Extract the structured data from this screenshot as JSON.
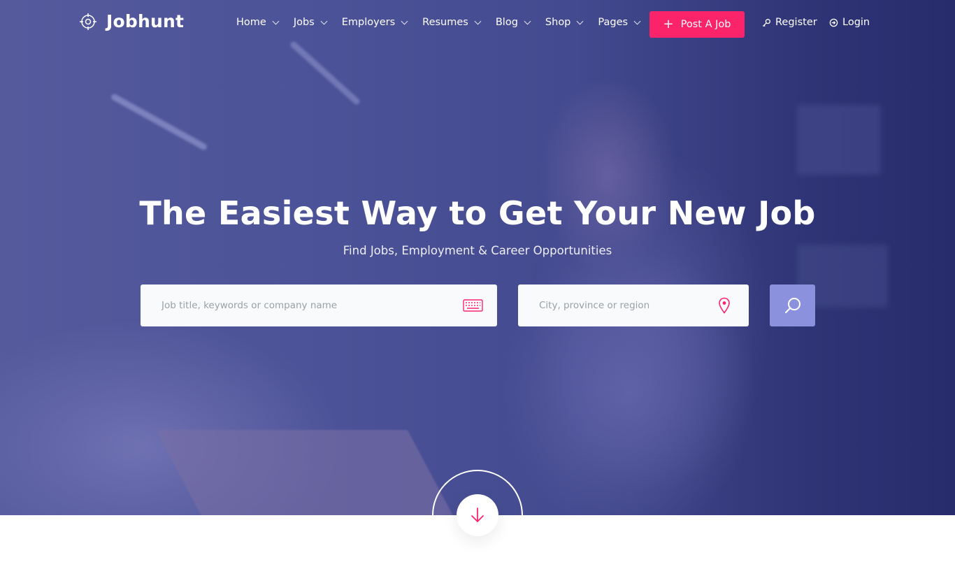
{
  "brand": {
    "name": "Jobhunt",
    "logo_icon": "crosshair-target-icon"
  },
  "nav": {
    "items": [
      {
        "label": "Home",
        "icon": "chevron-down-icon"
      },
      {
        "label": "Jobs",
        "icon": "chevron-down-icon"
      },
      {
        "label": "Employers",
        "icon": "chevron-down-icon"
      },
      {
        "label": "Resumes",
        "icon": "chevron-down-icon"
      },
      {
        "label": "Blog",
        "icon": "chevron-down-icon"
      },
      {
        "label": "Shop",
        "icon": "chevron-down-icon"
      },
      {
        "label": "Pages",
        "icon": "chevron-down-icon"
      }
    ],
    "post_job": {
      "label": "Post A Job",
      "icon": "plus-icon"
    },
    "register": {
      "label": "Register",
      "icon": "key-icon"
    },
    "login": {
      "label": "Login",
      "icon": "login-icon"
    }
  },
  "hero": {
    "title": "The Easiest Way to Get Your New Job",
    "subtitle": "Find Jobs, Employment & Career Opportunities"
  },
  "search": {
    "keyword": {
      "placeholder": "Job title, keywords or company name",
      "value": "",
      "icon": "keyboard-icon"
    },
    "location": {
      "placeholder": "City, province or region",
      "value": "",
      "icon": "map-pin-icon"
    },
    "button_icon": "search-icon"
  },
  "scroll_down": {
    "icon": "arrow-down-icon"
  },
  "colors": {
    "accent": "#fb236a",
    "search_button": "#8b91dd",
    "overlay": "#4c5297",
    "field_bg": "#f9fafb"
  }
}
